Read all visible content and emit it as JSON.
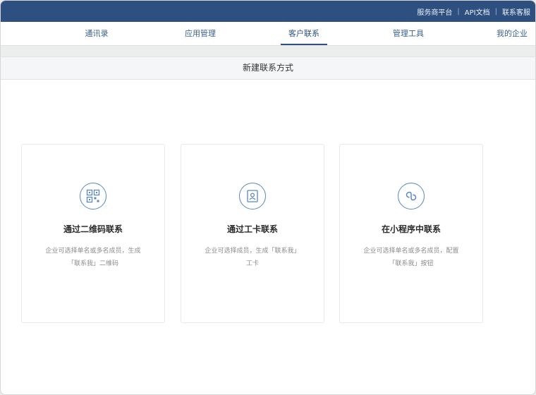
{
  "topbar": {
    "links": [
      "服务商平台",
      "API文档",
      "联系客服"
    ]
  },
  "nav": {
    "tabs": [
      {
        "label": "通讯录",
        "active": false
      },
      {
        "label": "应用管理",
        "active": false
      },
      {
        "label": "客户联系",
        "active": true
      },
      {
        "label": "管理工具",
        "active": false
      },
      {
        "label": "我的企业",
        "active": false
      }
    ]
  },
  "page": {
    "title": "新建联系方式"
  },
  "cards": [
    {
      "icon": "qr-code-icon",
      "title": "通过二维码联系",
      "desc_line1": "企业可选择单名或多名成员，生成",
      "desc_line2": "「联系我」二维码"
    },
    {
      "icon": "badge-icon",
      "title": "通过工卡联系",
      "desc_line1": "企业可选择成员，生成「联系我」",
      "desc_line2": "工卡"
    },
    {
      "icon": "mini-program-icon",
      "title": "在小程序中联系",
      "desc_line1": "企业可选择单名或多名成员，配置",
      "desc_line2": "「联系我」按钮"
    }
  ],
  "colors": {
    "brand": "#2e5080",
    "accent": "#5b87c0"
  }
}
